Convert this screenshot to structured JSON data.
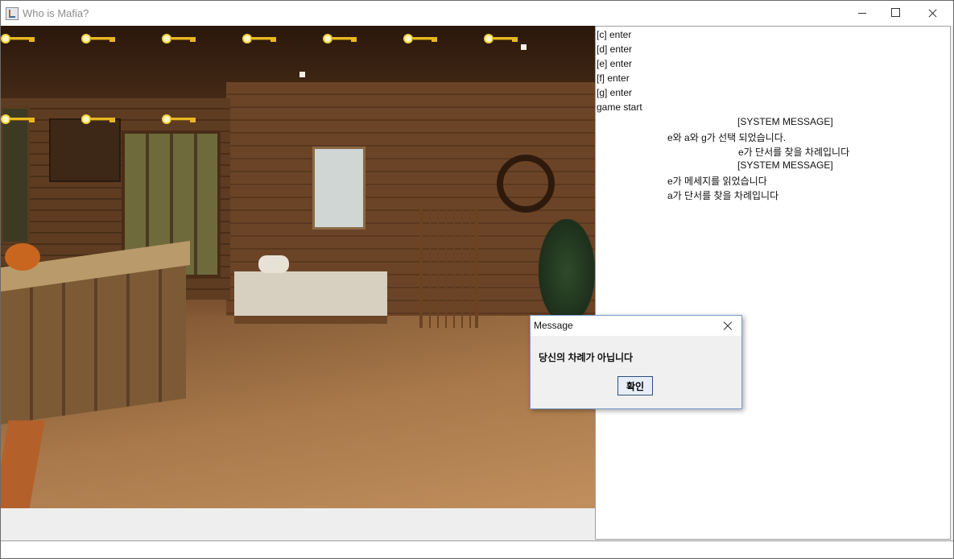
{
  "window": {
    "title": "Who is Mafia?"
  },
  "player_keys": [
    {
      "name": "key-1"
    },
    {
      "name": "key-2"
    },
    {
      "name": "key-3"
    },
    {
      "name": "key-4"
    },
    {
      "name": "key-5"
    },
    {
      "name": "key-6"
    },
    {
      "name": "key-7"
    },
    {
      "name": "key-8"
    },
    {
      "name": "key-9"
    },
    {
      "name": "key-10"
    }
  ],
  "chat": {
    "lines": [
      "[c] enter",
      "[d] enter",
      "[e] enter",
      "[f] enter",
      "[g] enter",
      "game start",
      "[SYSTEM MESSAGE]",
      "e와 a와 g가 선택 되었습니다.",
      "e가 단서를 찾을 차례입니다",
      "[SYSTEM MESSAGE]",
      "e가 메세지를 읽었습니다",
      "a가 단서를 찾을 차례입니다"
    ]
  },
  "dialog": {
    "title": "Message",
    "message": "당신의 차례가 아닙니다",
    "ok_label": "확인"
  }
}
